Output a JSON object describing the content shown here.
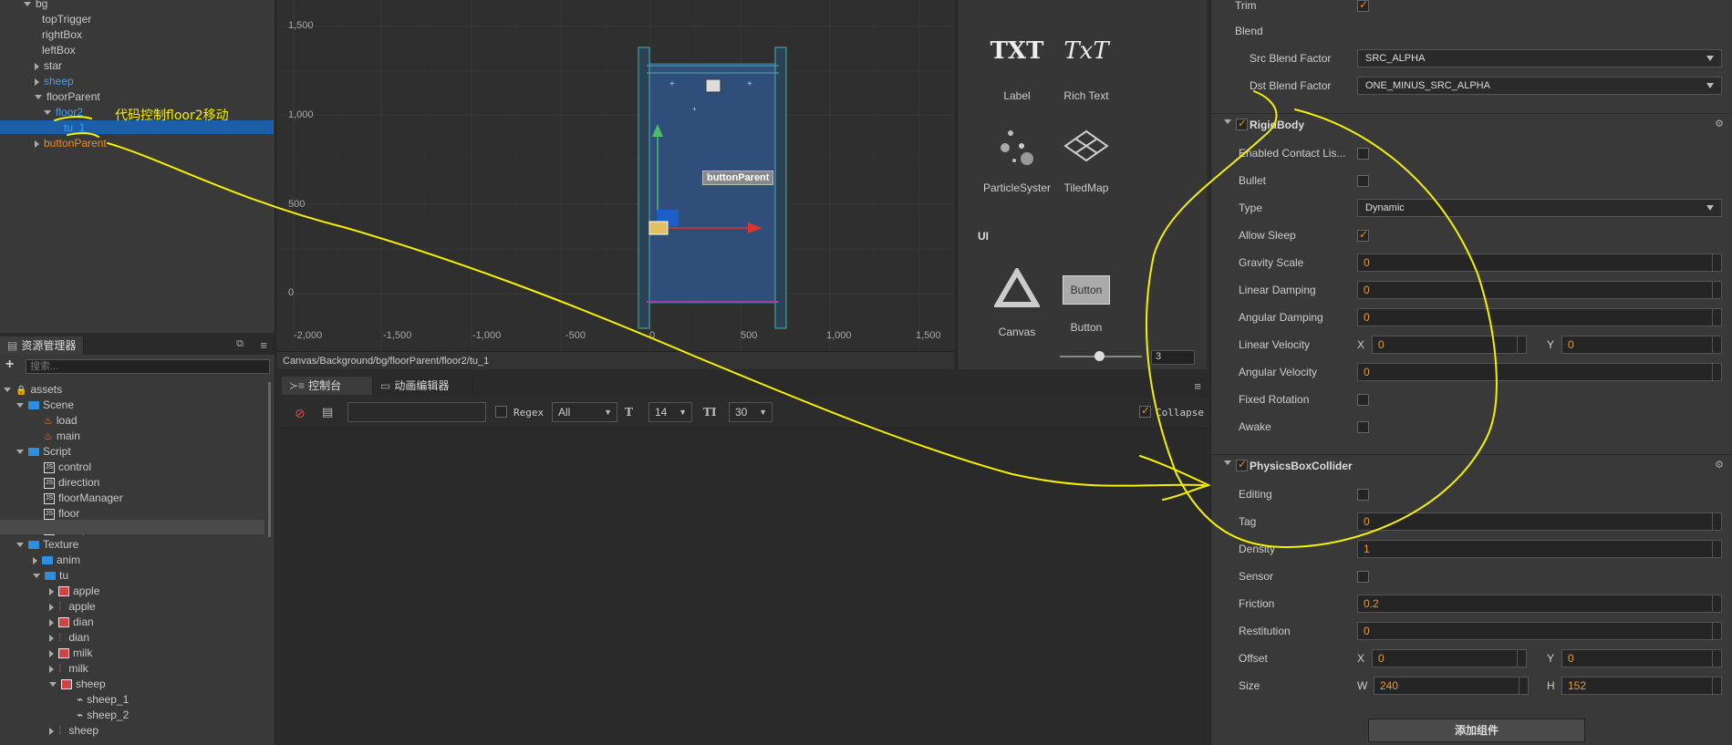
{
  "hierarchy": {
    "items": [
      {
        "label": "bg",
        "color": "white",
        "arrow": "down"
      },
      {
        "label": "topTrigger",
        "color": "white",
        "arrow": ""
      },
      {
        "label": "rightBox",
        "color": "white",
        "arrow": ""
      },
      {
        "label": "leftBox",
        "color": "white",
        "arrow": ""
      },
      {
        "label": "star",
        "color": "white",
        "arrow": "right"
      },
      {
        "label": "sheep",
        "color": "blue",
        "arrow": "right"
      },
      {
        "label": "floorParent",
        "color": "white",
        "arrow": "down"
      },
      {
        "label": "floor2",
        "color": "blue",
        "arrow": "down"
      },
      {
        "label": "tu_1",
        "color": "blue",
        "arrow": ""
      },
      {
        "label": "buttonParent",
        "color": "orange",
        "arrow": "right"
      }
    ],
    "annotation": "代码控制floor2移动"
  },
  "scene": {
    "y_ticks": [
      "1,500",
      "1,000",
      "500",
      "0"
    ],
    "x_ticks": [
      "-2,000",
      "-1,500",
      "-1,000",
      "-500",
      "0",
      "500",
      "1,000",
      "1,500"
    ],
    "node_label": "buttonParent",
    "path": "Canvas/Background/bg/floorParent/floor2/tu_1"
  },
  "library": {
    "items": [
      {
        "label": "Label",
        "icon_text": "TXT"
      },
      {
        "label": "Rich Text",
        "icon_text": "TxT"
      },
      {
        "label": "ParticleSyster",
        "icon_text": ""
      },
      {
        "label": "TiledMap",
        "icon_text": ""
      },
      {
        "label": "Canvas",
        "icon_text": ""
      },
      {
        "label": "Button",
        "icon_text": "Button"
      }
    ],
    "section_ui": "UI",
    "zoom_value": "3"
  },
  "assets": {
    "tab": "资源管理器",
    "search_placeholder": "搜索...",
    "items": [
      {
        "label": "assets",
        "type": "root",
        "arrow": "down"
      },
      {
        "label": "Scene",
        "type": "folder",
        "arrow": "down"
      },
      {
        "label": "load",
        "type": "fire",
        "arrow": ""
      },
      {
        "label": "main",
        "type": "fire",
        "arrow": ""
      },
      {
        "label": "Script",
        "type": "folder",
        "arrow": "down"
      },
      {
        "label": "control",
        "type": "js",
        "arrow": ""
      },
      {
        "label": "direction",
        "type": "js",
        "arrow": ""
      },
      {
        "label": "floorManager",
        "type": "js",
        "arrow": ""
      },
      {
        "label": "floor",
        "type": "js",
        "arrow": ""
      },
      {
        "label": "sheep",
        "type": "js",
        "arrow": ""
      },
      {
        "label": "Texture",
        "type": "folder",
        "arrow": "down"
      },
      {
        "label": "anim",
        "type": "folder",
        "arrow": "right"
      },
      {
        "label": "tu",
        "type": "folder",
        "arrow": "down"
      },
      {
        "label": "apple",
        "type": "img",
        "arrow": "right"
      },
      {
        "label": "apple",
        "type": "img2",
        "arrow": "right"
      },
      {
        "label": "dian",
        "type": "img",
        "arrow": "right"
      },
      {
        "label": "dian",
        "type": "img2",
        "arrow": "right"
      },
      {
        "label": "milk",
        "type": "img",
        "arrow": "right"
      },
      {
        "label": "milk",
        "type": "img2",
        "arrow": "right"
      },
      {
        "label": "sheep",
        "type": "img",
        "arrow": "down"
      },
      {
        "label": "sheep_1",
        "type": "sprite",
        "arrow": ""
      },
      {
        "label": "sheep_2",
        "type": "sprite",
        "arrow": ""
      },
      {
        "label": "sheep",
        "type": "img2",
        "arrow": "right"
      }
    ]
  },
  "console": {
    "tab_console": "控制台",
    "tab_anim": "动画编辑器",
    "regex_label": "Regex",
    "filter_value": "All",
    "font_size": "14",
    "line_count": "30",
    "collapse_label": "Collapse"
  },
  "inspector": {
    "trim_label": "Trim",
    "blend_label": "Blend",
    "src_blend_label": "Src Blend Factor",
    "src_blend_value": "SRC_ALPHA",
    "dst_blend_label": "Dst Blend Factor",
    "dst_blend_value": "ONE_MINUS_SRC_ALPHA",
    "rigidbody": {
      "title": "RigidBody",
      "enabled_contact": "Enabled Contact Lis...",
      "bullet": "Bullet",
      "type_label": "Type",
      "type_value": "Dynamic",
      "allow_sleep": "Allow Sleep",
      "gravity_scale": "Gravity Scale",
      "gravity_scale_value": "0",
      "linear_damping": "Linear Damping",
      "linear_damping_value": "0",
      "angular_damping": "Angular Damping",
      "angular_damping_value": "0",
      "linear_velocity": "Linear Velocity",
      "linear_velocity_x": "0",
      "linear_velocity_y": "0",
      "angular_velocity": "Angular Velocity",
      "angular_velocity_value": "0",
      "fixed_rotation": "Fixed Rotation",
      "awake": "Awake"
    },
    "collider": {
      "title": "PhysicsBoxCollider",
      "editing": "Editing",
      "tag": "Tag",
      "tag_value": "0",
      "density": "Density",
      "density_value": "1",
      "sensor": "Sensor",
      "friction": "Friction",
      "friction_value": "0.2",
      "restitution": "Restitution",
      "restitution_value": "0",
      "offset": "Offset",
      "offset_x": "0",
      "offset_y": "0",
      "size": "Size",
      "size_w": "240",
      "size_h": "152"
    },
    "x_label": "X",
    "y_label": "Y",
    "w_label": "W",
    "h_label": "H",
    "add_component": "添加组件"
  },
  "colors": {
    "accent_orange": "#f08a20",
    "selection_blue": "#1c5fa8",
    "annotation_yellow": "#f5f000"
  }
}
